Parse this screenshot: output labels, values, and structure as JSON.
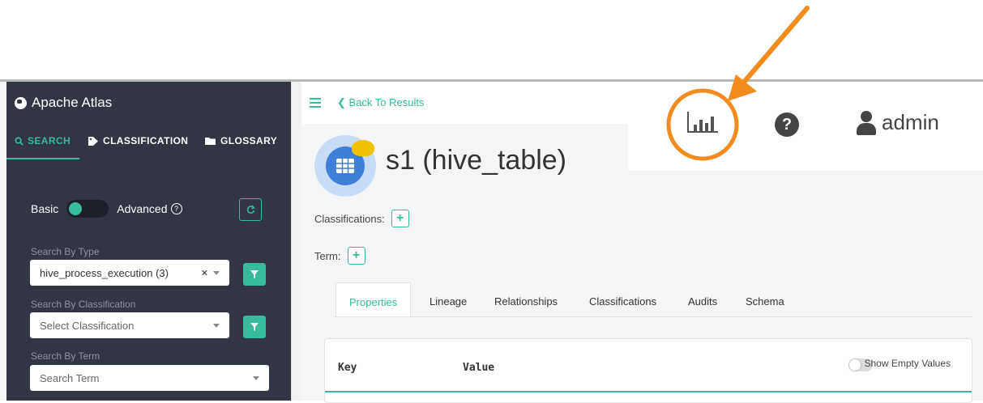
{
  "sidebar": {
    "app_title": "Apache Atlas",
    "tabs": [
      {
        "label": "SEARCH",
        "icon": "search-icon"
      },
      {
        "label": "CLASSIFICATION",
        "icon": "tag-icon"
      },
      {
        "label": "GLOSSARY",
        "icon": "folder-icon"
      }
    ],
    "toggle": {
      "left_label": "Basic",
      "right_label": "Advanced",
      "help_glyph": "?",
      "state": "basic"
    },
    "search_by_type": {
      "label": "Search By Type",
      "value": "hive_process_execution (3)"
    },
    "search_by_classification": {
      "label": "Search By Classification",
      "placeholder": "Select Classification"
    },
    "search_by_term": {
      "label": "Search By Term",
      "placeholder": "Search Term"
    }
  },
  "header": {
    "back_label": "Back To Results",
    "back_glyph": "❮",
    "help_glyph": "?",
    "user_name": "admin"
  },
  "entity": {
    "title": "s1 (hive_table)",
    "classifications_label": "Classifications:",
    "term_label": "Term:",
    "add_glyph": "+"
  },
  "detail_tabs": [
    "Properties",
    "Lineage",
    "Relationships",
    "Classifications",
    "Audits",
    "Schema"
  ],
  "properties_table": {
    "key_header": "Key",
    "value_header": "Value",
    "show_empty_label": "Show Empty Values"
  },
  "colors": {
    "accent": "#37bb9b",
    "sidebar_bg": "#323544",
    "annotation": "#f28c1e"
  }
}
